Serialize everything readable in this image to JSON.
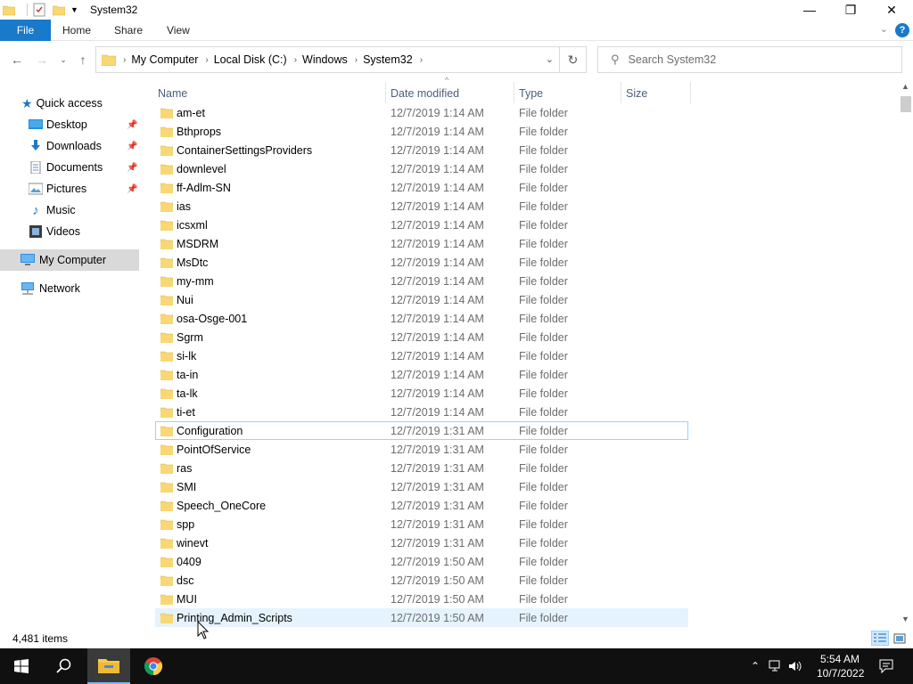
{
  "window": {
    "title": "System32",
    "controls": {
      "minimize": "—",
      "maximize": "❐",
      "close": "✕"
    }
  },
  "ribbon": {
    "file": "File",
    "tabs": [
      "Home",
      "Share",
      "View"
    ],
    "help": "?"
  },
  "address": {
    "crumbs": [
      "My Computer",
      "Local Disk (C:)",
      "Windows",
      "System32"
    ]
  },
  "search": {
    "placeholder": "Search System32"
  },
  "sidebar": {
    "quick_access": "Quick access",
    "items": [
      {
        "label": "Desktop",
        "icon": "desktop-icon",
        "pinned": true
      },
      {
        "label": "Downloads",
        "icon": "downloads-icon",
        "pinned": true
      },
      {
        "label": "Documents",
        "icon": "documents-icon",
        "pinned": true
      },
      {
        "label": "Pictures",
        "icon": "pictures-icon",
        "pinned": true
      },
      {
        "label": "Music",
        "icon": "music-icon",
        "pinned": false
      },
      {
        "label": "Videos",
        "icon": "videos-icon",
        "pinned": false
      }
    ],
    "this_pc": "My Computer",
    "network": "Network"
  },
  "columns": {
    "name": "Name",
    "date": "Date modified",
    "type": "Type",
    "size": "Size"
  },
  "files": [
    {
      "name": "am-et",
      "date": "12/7/2019 1:14 AM",
      "type": "File folder"
    },
    {
      "name": "Bthprops",
      "date": "12/7/2019 1:14 AM",
      "type": "File folder"
    },
    {
      "name": "ContainerSettingsProviders",
      "date": "12/7/2019 1:14 AM",
      "type": "File folder"
    },
    {
      "name": "downlevel",
      "date": "12/7/2019 1:14 AM",
      "type": "File folder"
    },
    {
      "name": "ff-Adlm-SN",
      "date": "12/7/2019 1:14 AM",
      "type": "File folder"
    },
    {
      "name": "ias",
      "date": "12/7/2019 1:14 AM",
      "type": "File folder"
    },
    {
      "name": "icsxml",
      "date": "12/7/2019 1:14 AM",
      "type": "File folder"
    },
    {
      "name": "MSDRM",
      "date": "12/7/2019 1:14 AM",
      "type": "File folder"
    },
    {
      "name": "MsDtc",
      "date": "12/7/2019 1:14 AM",
      "type": "File folder"
    },
    {
      "name": "my-mm",
      "date": "12/7/2019 1:14 AM",
      "type": "File folder"
    },
    {
      "name": "Nui",
      "date": "12/7/2019 1:14 AM",
      "type": "File folder"
    },
    {
      "name": "osa-Osge-001",
      "date": "12/7/2019 1:14 AM",
      "type": "File folder"
    },
    {
      "name": "Sgrm",
      "date": "12/7/2019 1:14 AM",
      "type": "File folder"
    },
    {
      "name": "si-lk",
      "date": "12/7/2019 1:14 AM",
      "type": "File folder"
    },
    {
      "name": "ta-in",
      "date": "12/7/2019 1:14 AM",
      "type": "File folder"
    },
    {
      "name": "ta-lk",
      "date": "12/7/2019 1:14 AM",
      "type": "File folder"
    },
    {
      "name": "ti-et",
      "date": "12/7/2019 1:14 AM",
      "type": "File folder"
    },
    {
      "name": "Configuration",
      "date": "12/7/2019 1:31 AM",
      "type": "File folder",
      "state": "focused"
    },
    {
      "name": "PointOfService",
      "date": "12/7/2019 1:31 AM",
      "type": "File folder"
    },
    {
      "name": "ras",
      "date": "12/7/2019 1:31 AM",
      "type": "File folder"
    },
    {
      "name": "SMI",
      "date": "12/7/2019 1:31 AM",
      "type": "File folder"
    },
    {
      "name": "Speech_OneCore",
      "date": "12/7/2019 1:31 AM",
      "type": "File folder"
    },
    {
      "name": "spp",
      "date": "12/7/2019 1:31 AM",
      "type": "File folder"
    },
    {
      "name": "winevt",
      "date": "12/7/2019 1:31 AM",
      "type": "File folder"
    },
    {
      "name": "0409",
      "date": "12/7/2019 1:50 AM",
      "type": "File folder"
    },
    {
      "name": "dsc",
      "date": "12/7/2019 1:50 AM",
      "type": "File folder"
    },
    {
      "name": "MUI",
      "date": "12/7/2019 1:50 AM",
      "type": "File folder"
    },
    {
      "name": "Printing_Admin_Scripts",
      "date": "12/7/2019 1:50 AM",
      "type": "File folder",
      "state": "hover"
    }
  ],
  "status": {
    "item_count": "4,481 items"
  },
  "taskbar": {
    "clock_time": "5:54 AM",
    "clock_date": "10/7/2022"
  },
  "colors": {
    "accent": "#1979ca",
    "folder": "#f8d775",
    "folder_dark": "#e0b13a",
    "selection_border": "#99d1ff",
    "hover_bg": "#e5f3ff",
    "taskbar": "#101010"
  }
}
